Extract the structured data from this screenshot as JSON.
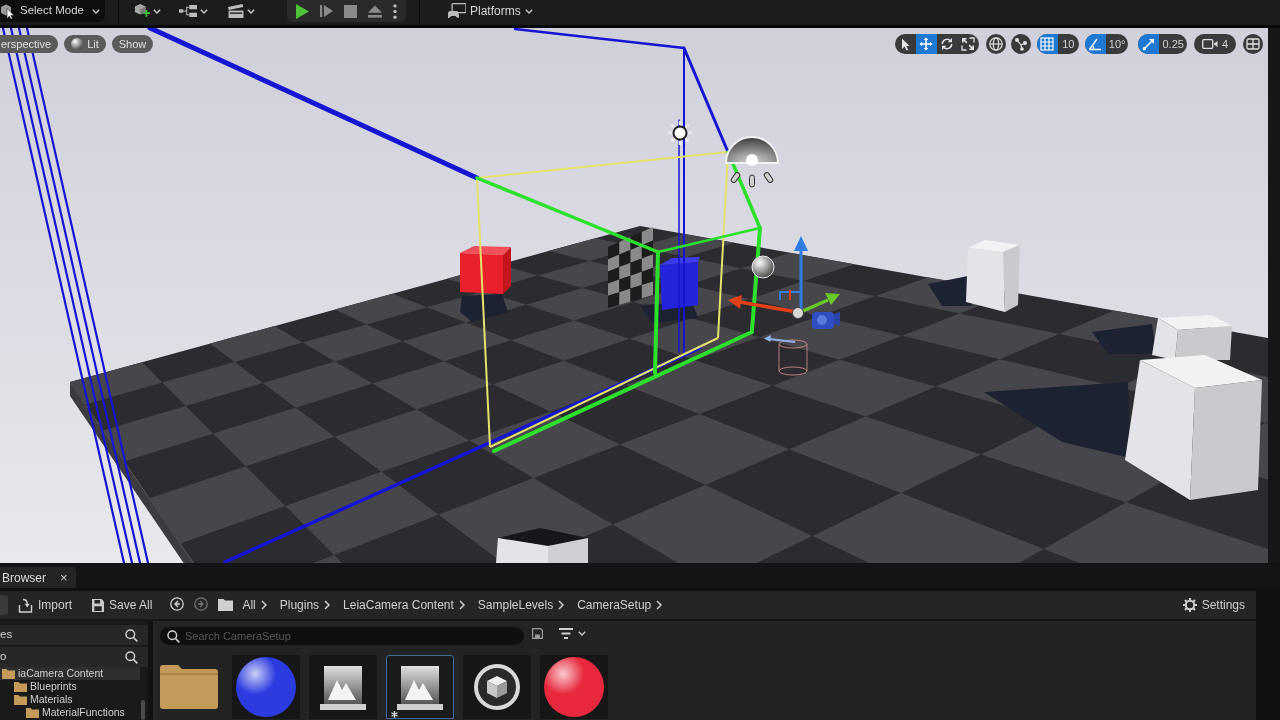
{
  "toolbar": {
    "mode_button": {
      "label": "Select Mode"
    },
    "platforms_button": {
      "label": "Platforms"
    }
  },
  "viewport": {
    "view_buttons": [
      {
        "kind": "text",
        "label": "erspective"
      },
      {
        "kind": "lit",
        "label": "Lit"
      },
      {
        "kind": "text",
        "label": "Show"
      }
    ],
    "transform_tools": [
      {
        "kind": "select",
        "selected": false
      },
      {
        "kind": "move",
        "selected": true
      },
      {
        "kind": "rotate",
        "selected": false
      },
      {
        "kind": "scale",
        "selected": false
      }
    ],
    "snaps": [
      {
        "kind": "grid",
        "on": true,
        "value": "10"
      },
      {
        "kind": "angle",
        "on": true,
        "value": "10°"
      },
      {
        "kind": "scale",
        "on": true,
        "value": "0.25"
      }
    ],
    "camera_speed": {
      "value": "4"
    }
  },
  "content_browser": {
    "tab": {
      "label": "Browser",
      "close": "×"
    },
    "actions": [
      {
        "kind": "import",
        "label": "Import"
      },
      {
        "kind": "save",
        "label": "Save All"
      }
    ],
    "history": [
      {
        "kind": "back",
        "disabled": false
      },
      {
        "kind": "forward",
        "disabled": true
      }
    ],
    "path": [
      "All",
      "Plugins",
      "LeiaCamera Content",
      "SampleLevels",
      "CameraSetup"
    ],
    "settings": {
      "label": "Settings"
    },
    "sections": [
      {
        "label": "es"
      },
      {
        "label": "o"
      }
    ],
    "folders": [
      {
        "label": "iaCamera Content",
        "selected": true,
        "children": [
          {
            "label": "Blueprints",
            "selected": false
          },
          {
            "label": "Materials",
            "selected": false,
            "children": [
              {
                "label": "MaterialFunctions",
                "selected": false
              }
            ]
          }
        ]
      }
    ],
    "search": {
      "placeholder": "Search CameraSetup"
    },
    "assets": [
      {
        "kind": "folder",
        "selected": false,
        "modified": false
      },
      {
        "kind": "sphere",
        "color": "#2b3be0",
        "selected": false,
        "modified": false
      },
      {
        "kind": "texture",
        "selected": false,
        "modified": false
      },
      {
        "kind": "texture",
        "selected": true,
        "modified": true
      },
      {
        "kind": "mesh",
        "selected": false,
        "modified": false
      },
      {
        "kind": "sphere",
        "color": "#e8283c",
        "selected": false,
        "modified": false
      }
    ]
  }
}
